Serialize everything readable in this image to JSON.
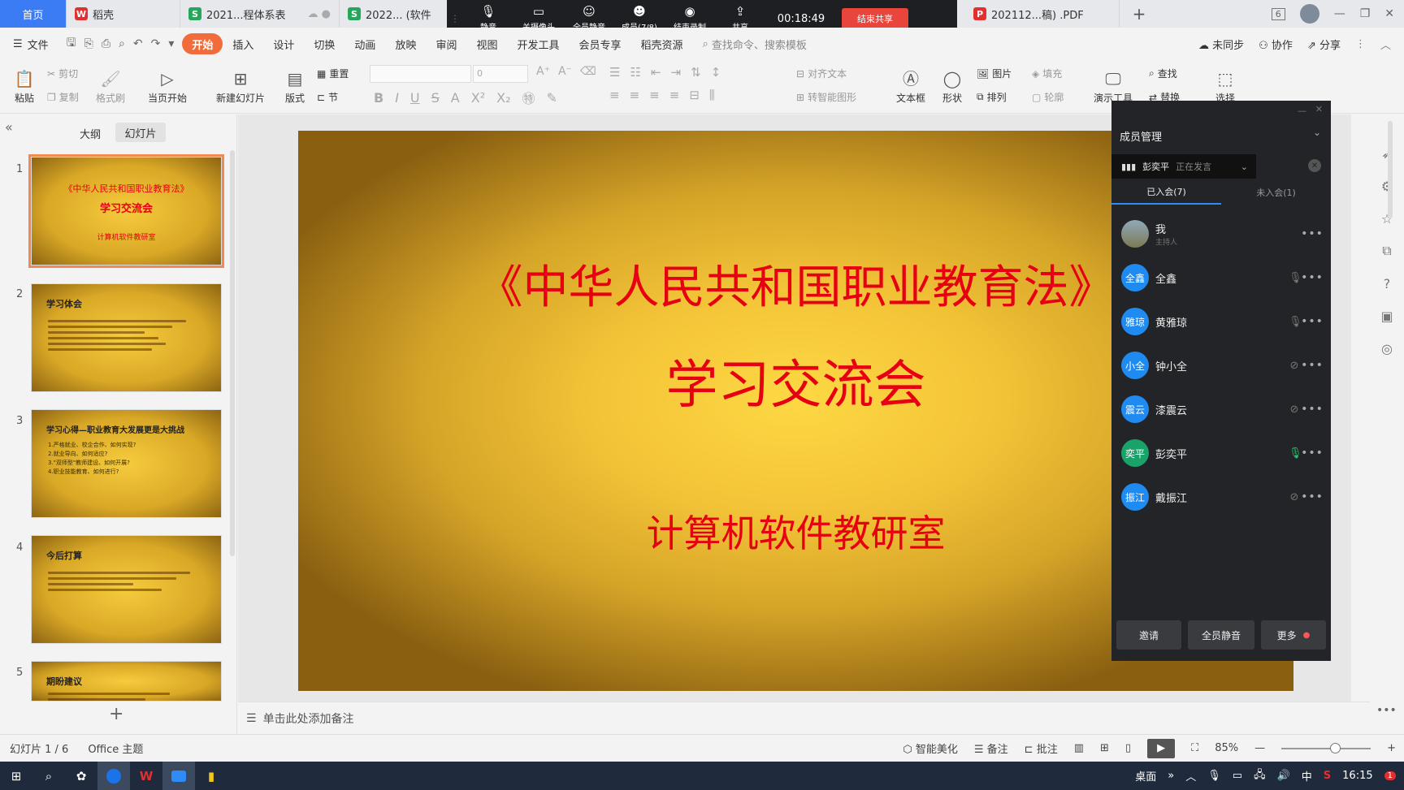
{
  "tabbar": {
    "tabs": [
      {
        "label": "首页",
        "active": true
      },
      {
        "label": "稻壳",
        "icon": "docer-icon",
        "color": "#e03030"
      },
      {
        "label": "2021...程体系表",
        "icon": "sheet-icon",
        "color": "#26a65b"
      },
      {
        "label": "2022... (软件",
        "icon": "sheet-icon",
        "color": "#26a65b"
      },
      {
        "label": "202112...稿) .PDF",
        "icon": "pdf-icon",
        "color": "#e03030"
      }
    ],
    "window_badge": "6"
  },
  "meeting_bar": {
    "buttons": [
      {
        "label": "静音",
        "glyph": "🎙"
      },
      {
        "label": "关摄像头",
        "glyph": "▭"
      },
      {
        "label": "全员静音",
        "glyph": "☺"
      },
      {
        "label": "成员(7/8)",
        "glyph": "☻"
      },
      {
        "label": "结束录制",
        "glyph": "◉"
      },
      {
        "label": "共享",
        "glyph": "⇪"
      }
    ],
    "timer": "00:18:49",
    "end_share": "结束共享"
  },
  "menu": {
    "file": "文件",
    "items": [
      "开始",
      "插入",
      "设计",
      "切换",
      "动画",
      "放映",
      "审阅",
      "视图",
      "开发工具",
      "会员专享",
      "稻壳资源"
    ],
    "active": "开始",
    "search_placeholder": "查找命令、搜索模板",
    "sync": "未同步",
    "collab": "协作",
    "share": "分享"
  },
  "ribbon": {
    "paste": "粘贴",
    "cut": "剪切",
    "copy": "复制",
    "format_painter": "格式刷",
    "from_current": "当页开始",
    "new_slide": "新建幻灯片",
    "layout": "版式",
    "section": "节",
    "reset": "重置",
    "font_size": "0",
    "align_text": "对齐文本",
    "smart_art": "转智能图形",
    "textbox": "文本框",
    "shape": "形状",
    "arrange": "排列",
    "picture": "图片",
    "fill": "填充",
    "outline": "轮廓",
    "present_tool": "演示工具",
    "find": "查找",
    "replace": "替换",
    "select": "选择"
  },
  "left_panel": {
    "tab_outline": "大纲",
    "tab_slides": "幻灯片",
    "slides": [
      {
        "num": "1",
        "line1": "《中华人民共和国职业教育法》",
        "line2": "学习交流会",
        "line3": "计算机软件教研室"
      },
      {
        "num": "2",
        "title": "学习体会"
      },
      {
        "num": "3",
        "title": "学习心得—职业教育大发展更是大挑战",
        "lines": [
          "1.严格就业、校企合作、如何实现?",
          "2.就业导向、如何适应?",
          "3.\"双师型\"教师建设、如何开展?",
          "4.职业技能教育、如何进行?"
        ]
      },
      {
        "num": "4",
        "title": "今后打算"
      },
      {
        "num": "5",
        "title": "期盼建议"
      }
    ],
    "add": "+"
  },
  "slide": {
    "line1": "《中华人民共和国职业教育法》",
    "line2": "学习交流会",
    "line3": "计算机软件教研室"
  },
  "member_panel": {
    "title": "成员管理",
    "speaker_name": "彭奕平",
    "speaker_status": "正在发言",
    "tab_joined": "已入会(7)",
    "tab_not_joined": "未入会(1)",
    "members": [
      {
        "name": "我",
        "sub": "主持人",
        "avatar": ""
      },
      {
        "name": "全鑫",
        "avatar": "全鑫"
      },
      {
        "name": "黄雅琼",
        "avatar": "雅琼"
      },
      {
        "name": "钟小全",
        "avatar": "小全"
      },
      {
        "name": "漆震云",
        "avatar": "震云"
      },
      {
        "name": "彭奕平",
        "avatar": "奕平"
      },
      {
        "name": "戴振江",
        "avatar": "振江"
      }
    ],
    "invite": "邀请",
    "mute_all": "全员静音",
    "more": "更多"
  },
  "notes": {
    "placeholder": "单击此处添加备注"
  },
  "status": {
    "slide_info": "幻灯片 1 / 6",
    "theme": "Office 主题",
    "beautify": "智能美化",
    "notes": "备注",
    "comment": "批注",
    "zoom": "85%"
  },
  "taskbar": {
    "desktop": "桌面",
    "ime": "中",
    "time": "16:15",
    "notification": "1"
  }
}
